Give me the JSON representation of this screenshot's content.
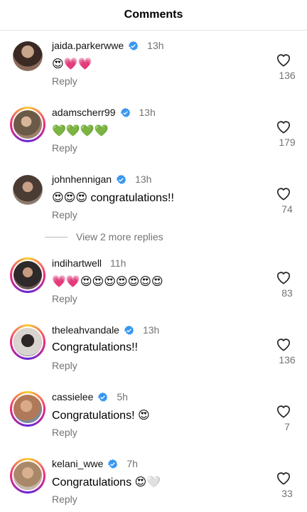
{
  "header": {
    "title": "Comments"
  },
  "comments": [
    {
      "username": "jaida.parkerwwe",
      "verified": true,
      "time": "13h",
      "text": "😍💗💗",
      "reply": "Reply",
      "likes": "136",
      "avatar_color": "#5b3b2f"
    },
    {
      "username": "adamscherr99",
      "verified": true,
      "time": "13h",
      "text": "💚💚💚💚",
      "reply": "Reply",
      "likes": "179",
      "avatar_color": "#6b5a48"
    },
    {
      "username": "johnhennigan",
      "verified": true,
      "time": "13h",
      "text": "😍😍😍 congratulations!!",
      "reply": "Reply",
      "likes": "74",
      "avatar_color": "#4a3b33"
    },
    {
      "username": "indihartwell",
      "verified": false,
      "time": "11h",
      "text": "💗💗😍😍😍😍😍😍😍",
      "reply": "Reply",
      "likes": "83",
      "avatar_color": "#2f2a2a"
    },
    {
      "username": "theleahvandale",
      "verified": true,
      "time": "13h",
      "text": "Congratulations!!",
      "reply": "Reply",
      "likes": "136",
      "avatar_color": "#3a3230"
    },
    {
      "username": "cassielee",
      "verified": true,
      "time": "5h",
      "text": "Congratulations! 😍",
      "reply": "Reply",
      "likes": "7",
      "avatar_color": "#b07a5a"
    },
    {
      "username": "kelani_wwe",
      "verified": true,
      "time": "7h",
      "text": "Congratulations 😍🤍",
      "reply": "Reply",
      "likes": "33",
      "avatar_color": "#a88868"
    }
  ],
  "view_more_replies": "View 2 more replies",
  "colors": {
    "verified": "#3897f0",
    "muted": "#737373"
  }
}
